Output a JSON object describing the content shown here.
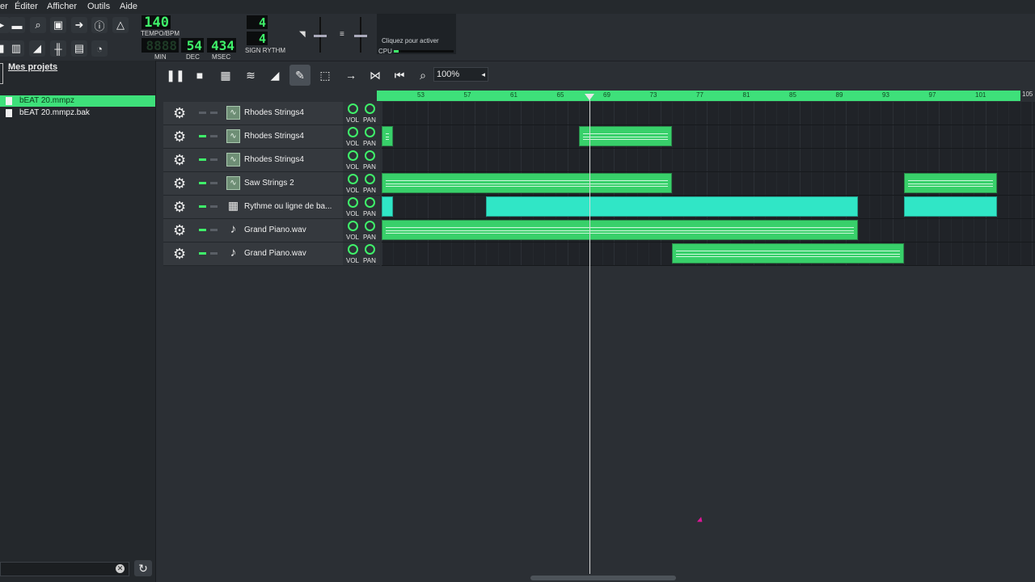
{
  "menu": [
    "er",
    "Éditer",
    "Afficher",
    "Outils",
    "Aide"
  ],
  "toolbar": {
    "tempo": "140",
    "tempo_label": "TEMPO/BPM",
    "time_min": "8888",
    "time_sec": "54",
    "time_msec": "434",
    "min_label": "MIN",
    "sec_label": "DEC",
    "msec_label": "MSEC",
    "sig_top": "4",
    "sig_bottom": "4",
    "sig_label": "SIGN RYTHM",
    "activate_text": "Cliquez pour activer",
    "cpu_label": "CPU",
    "cpu_usage": 0.08
  },
  "sidebar": {
    "title": "Mes projets",
    "files": [
      {
        "name": "bEAT 20.mmpz",
        "selected": true
      },
      {
        "name": "bEAT 20.mmpz.bak",
        "selected": false
      }
    ]
  },
  "song_toolbar": {
    "zoom": "100%"
  },
  "ruler": {
    "labels": [
      "53",
      "57",
      "61",
      "65",
      "69",
      "73",
      "77",
      "81",
      "85",
      "89",
      "93",
      "97",
      "101"
    ],
    "end_label": "105"
  },
  "tracks": [
    {
      "name": "Rhodes Strings4",
      "type": "inst",
      "mute_on": false,
      "clips": []
    },
    {
      "name": "Rhodes Strings4",
      "type": "inst",
      "mute_on": true,
      "clips": [
        {
          "from": 0,
          "len": 1,
          "color": "green"
        },
        {
          "from": 17,
          "len": 8,
          "color": "green"
        }
      ]
    },
    {
      "name": "Rhodes Strings4",
      "type": "inst",
      "mute_on": true,
      "clips": []
    },
    {
      "name": "Saw Strings 2",
      "type": "inst",
      "mute_on": true,
      "clips": [
        {
          "from": 0,
          "len": 25,
          "color": "green"
        },
        {
          "from": 45,
          "len": 8,
          "color": "green"
        }
      ]
    },
    {
      "name": "Rythme ou ligne de ba...",
      "type": "beat",
      "mute_on": true,
      "clips": [
        {
          "from": 0,
          "len": 1,
          "color": "cyan"
        },
        {
          "from": 9,
          "len": 32,
          "color": "cyan"
        },
        {
          "from": 45,
          "len": 8,
          "color": "cyan"
        }
      ]
    },
    {
      "name": "Grand Piano.wav",
      "type": "sample",
      "mute_on": true,
      "clips": [
        {
          "from": 0,
          "len": 41,
          "color": "green"
        }
      ]
    },
    {
      "name": "Grand Piano.wav",
      "type": "sample",
      "mute_on": true,
      "clips": [
        {
          "from": 25,
          "len": 20,
          "color": "green"
        }
      ]
    }
  ],
  "knob_labels": {
    "vol": "VOL",
    "pan": "PAN"
  },
  "colors": {
    "clip_green": "#38d06a",
    "clip_cyan": "#30e6c6",
    "lcd": "#3ff26a"
  }
}
